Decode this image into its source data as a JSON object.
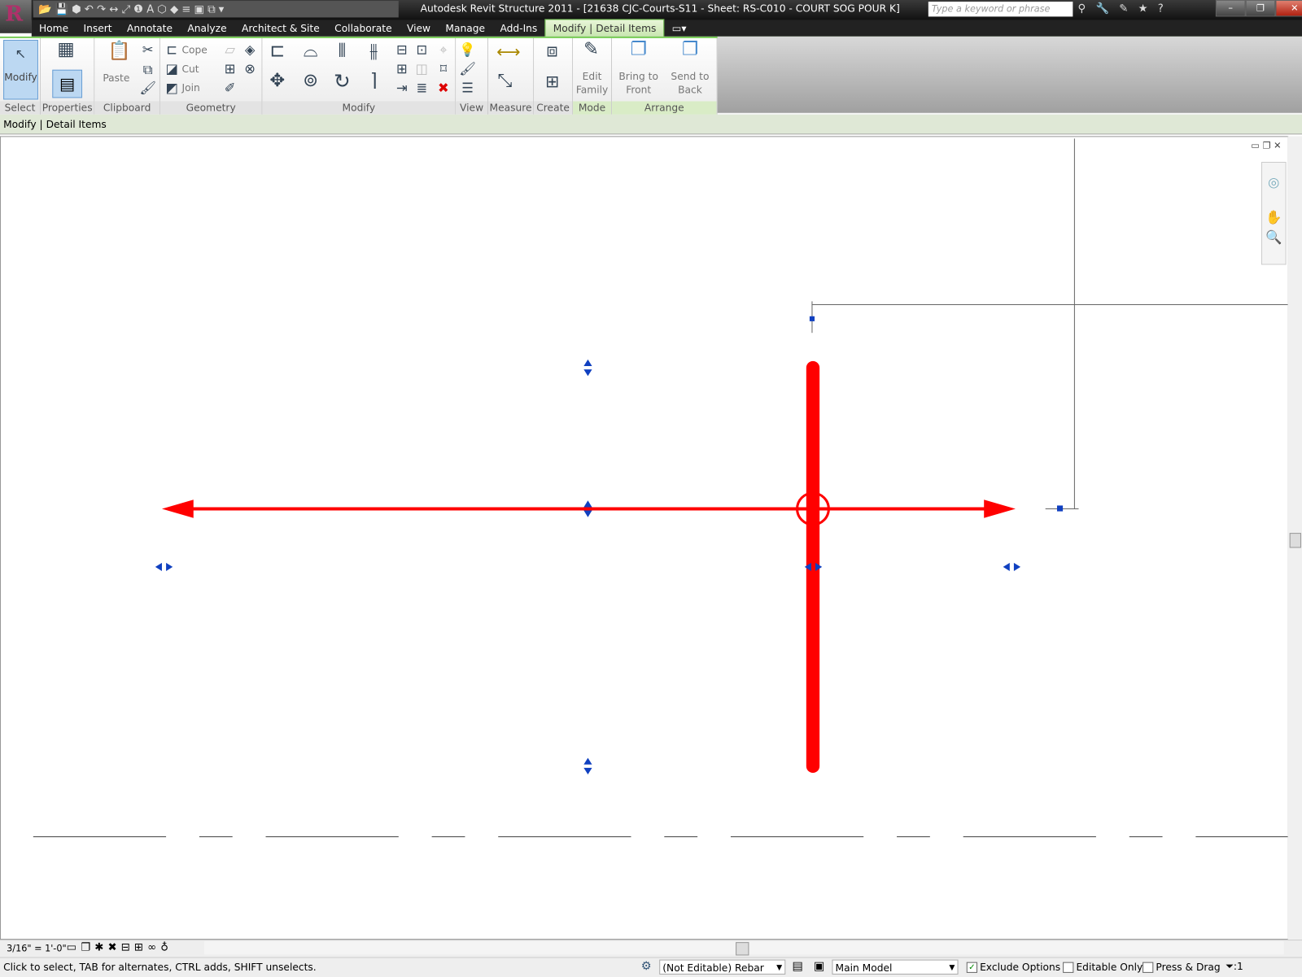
{
  "title": "Autodesk Revit Structure 2011 - [21638 CJC-Courts-S11 - Sheet: RS-C010 - COURT SOG POUR K]",
  "app_letter": "R",
  "search_placeholder": "Type a keyword or phrase",
  "tabs": [
    "Home",
    "Insert",
    "Annotate",
    "Analyze",
    "Architect & Site",
    "Collaborate",
    "View",
    "Manage",
    "Add-Ins",
    "Modify | Detail Items"
  ],
  "ribbon": {
    "panels": [
      "Select",
      "Properties",
      "Clipboard",
      "Geometry",
      "Modify",
      "View",
      "Measure",
      "Create",
      "Mode",
      "Arrange"
    ],
    "modify": "Modify",
    "paste": "Paste",
    "cope": "Cope",
    "cut": "Cut",
    "join": "Join",
    "edit_family": [
      "Edit",
      "Family"
    ],
    "bring_to_front": [
      "Bring to",
      "Front"
    ],
    "send_to_back": [
      "Send to",
      "Back"
    ]
  },
  "context_label": "Modify | Detail Items",
  "view_scale": "3/16\" = 1'-0\"",
  "status": {
    "hint": "Click to select, TAB for alternates, CTRL adds, SHIFT unselects.",
    "type_selector": "(Not Editable) Rebar",
    "workset": "Main Model",
    "exclude_options": "Exclude Options",
    "editable_only": "Editable Only",
    "press_drag": "Press & Drag",
    "filter_count": ":1"
  },
  "colors": {
    "rebar": "#ff0000",
    "grip": "#1040c0",
    "ribbon_accent": "#77cc55"
  }
}
